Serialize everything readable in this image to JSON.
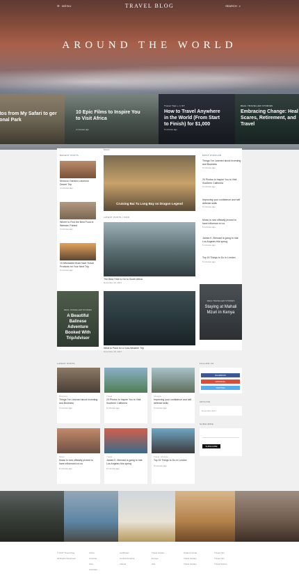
{
  "header": {
    "menu_label": "MENU",
    "logo": "TRAVEL BLOG",
    "search_label": "SEARCH",
    "hero_title": "AROUND THE WORLD"
  },
  "slider": [
    {
      "tag": "",
      "title": "Photos from My Safari to ger National Park",
      "meta": ""
    },
    {
      "tag": "",
      "title": "10 Epic Films to Inspire You to Visit Africa",
      "meta": "3 minutes ago"
    },
    {
      "tag": "Travel Tips + 1 ST",
      "title": "How to Travel Anywhere in the World (From Start to Finish) for $1,000",
      "meta": "5 minutes ago"
    },
    {
      "tag": "REAL TRAVELLER STORIES",
      "title": "Embracing Change: Heal Scares, Retirement, and Travel",
      "meta": ""
    }
  ],
  "recent_posts": {
    "label": "RECENT POSTS",
    "items": [
      {
        "title": "Morocco Sahara Luxurious Desert Trip",
        "meta": "4 minutes ago"
      },
      {
        "title": "Where to Find the Best Food in Warsaw, Poland",
        "meta": "4 minutes ago"
      },
      {
        "title": "10 Affordable Must-Have Travel Products for Your Next Trip",
        "meta": "5 minutes ago"
      }
    ],
    "featured": {
      "tag": "REAL TRAVELLER STORIES",
      "title": "A Beautiful Balinese Adventure Booked With TripAdvisor"
    }
  },
  "center": {
    "label1": "MAIN",
    "big1": {
      "title": "Cruising Bai Tu Long Bay on Dragon Legend"
    },
    "label2": "LATEST POSTS / INFO",
    "big2": {
      "caption": "The Best Time to Go to South Africa",
      "meta": "November 10, 2017"
    },
    "big3": {
      "caption": "What to Pack for a Cold-Weather Trip",
      "meta": "November 10, 2017"
    }
  },
  "most_popular": {
    "label": "MOST POPULAR",
    "items": [
      {
        "title": "Things I've Learned about Investing and Business",
        "meta": "5 minutes ago"
      },
      {
        "title": "20 Photos to Inspire You to Visit Southern California",
        "meta": "5 minutes ago"
      },
      {
        "title": "Improving your confidence and self defense skills",
        "meta": "5 minutes ago"
      },
      {
        "title": "Music is now officially proved to have influence on us",
        "meta": "5 minutes ago"
      },
      {
        "title": "James K. Bernard is going to ride Los Angeles this spring",
        "meta": "5 minutes ago"
      },
      {
        "title": "Top 15 Things to Do in London",
        "meta": "5 minutes ago"
      }
    ],
    "featured": {
      "tag": "REAL TRAVELLER STORIES",
      "title": "Staying at Mahali Mzuri in Kenya"
    }
  },
  "latest_posts": {
    "label": "LATEST POSTS",
    "cards": [
      {
        "cat": "Business",
        "title": "Things I've Learned about Investing and Business",
        "meta": "5 minutes ago"
      },
      {
        "cat": "Travel",
        "title": "20 Photos to Inspire You to Visit Southern California",
        "meta": "5 minutes ago"
      },
      {
        "cat": "Lifestyle",
        "title": "Improving your confidence and self defense skills",
        "meta": "5 minutes ago"
      },
      {
        "cat": "Music",
        "title": "Music is now officially proved to have influenced on us",
        "meta": "5 minutes ago"
      },
      {
        "cat": "Travel",
        "title": "James K. Bernard is going to ride Los Angeles this spring",
        "meta": "5 minutes ago"
      },
      {
        "cat": "Travel, Lifestyle",
        "title": "Top 15 Things to Do in London",
        "meta": "5 minutes ago"
      }
    ]
  },
  "sidebar": {
    "follow_label": "FOLLOW US",
    "buttons": [
      "FACEBOOK",
      "GOOGLE+",
      "TWITTER"
    ],
    "archive_label": "ARCHIVE",
    "archive_value": "November 2017",
    "subscribe_label": "SUBSCRIBE",
    "subscribe_btn": "SUBSCRIBE"
  },
  "footer": {
    "copyright": "© 2017 Travel blog.",
    "rights": "All Rights Reserved.",
    "col1": [
      "Africa",
      "America",
      "Asia",
      "Australia"
    ],
    "col2": [
      "Caribbean",
      "Central America",
      "Ireland"
    ],
    "col3": [
      "Travel Guides",
      "Europe",
      "Arts"
    ],
    "col4": [
      "Student Guide",
      "Travel Guides",
      "Travel Guides"
    ],
    "col5": [
      "Travel Tips",
      "Travel Tips",
      "Travel Stories"
    ]
  }
}
